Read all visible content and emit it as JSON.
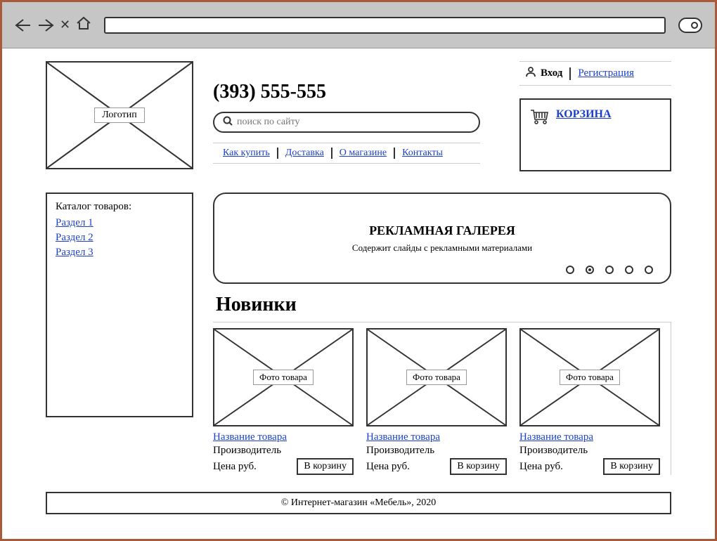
{
  "header": {
    "logo_label": "Логотип",
    "phone": "(393) 555-555",
    "search_placeholder": "поиск по сайту",
    "nav": [
      "Как купить",
      "Доставка",
      "О магазине",
      "Контакты"
    ],
    "login_label": "Вход",
    "register_label": "Регистрация",
    "cart_label": "КОРЗИНА"
  },
  "catalog": {
    "title": "Каталог товаров:",
    "sections": [
      "Раздел 1",
      "Раздел 2",
      "Раздел 3"
    ]
  },
  "banner": {
    "title": "РЕКЛАМНАЯ ГАЛЕРЕЯ",
    "subtitle": "Содержит слайды с рекламными материалами",
    "dots": 5,
    "active_dot": 1
  },
  "new_arrivals": {
    "heading": "Новинки",
    "products": [
      {
        "img_label": "Фото товара",
        "name": "Название товара",
        "maker": "Производитель",
        "price": "Цена руб.",
        "btn": "В корзину"
      },
      {
        "img_label": "Фото товара",
        "name": "Название товара",
        "maker": "Производитель",
        "price": "Цена руб.",
        "btn": "В корзину"
      },
      {
        "img_label": "Фото товара",
        "name": "Название товара",
        "maker": "Производитель",
        "price": "Цена руб.",
        "btn": "В корзину"
      }
    ]
  },
  "footer": "© Интернет-магазин «Мебель», 2020"
}
